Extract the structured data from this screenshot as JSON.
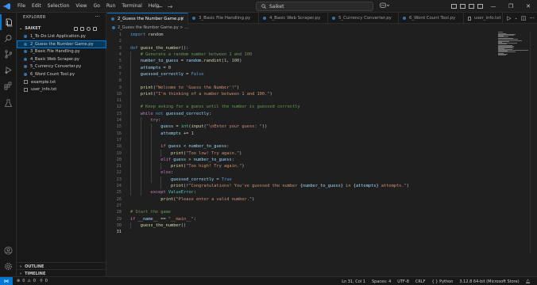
{
  "menu": [
    "File",
    "Edit",
    "Selection",
    "View",
    "Go",
    "Run",
    "Terminal",
    "Help"
  ],
  "search": {
    "text": "Saiket"
  },
  "explorer": {
    "title": "EXPLORER",
    "folder": "SAIKET",
    "files": [
      {
        "name": "1_To-Do List Application.py",
        "type": "python"
      },
      {
        "name": "2_Guess the Number Game.py",
        "type": "python",
        "selected": true
      },
      {
        "name": "3_Basic File Handling.py",
        "type": "python"
      },
      {
        "name": "4_Basic Web Scraper.py",
        "type": "python"
      },
      {
        "name": "5_Currency Converter.py",
        "type": "python"
      },
      {
        "name": "6_Word Count Tool.py",
        "type": "python"
      },
      {
        "name": "example.txt",
        "type": "text"
      },
      {
        "name": "user_info.txt",
        "type": "text"
      }
    ],
    "outline": "OUTLINE",
    "timeline": "TIMELINE"
  },
  "tabs": [
    {
      "label": "2_Guess the Number Game.py",
      "active": true
    },
    {
      "label": "3_Basic File Handling.py"
    },
    {
      "label": "4_Basic Web Scraper.py"
    },
    {
      "label": "5_Currency Converter.py"
    },
    {
      "label": "6_Word Count Tool.py"
    },
    {
      "label": "user_info.txt"
    }
  ],
  "breadcrumb": "2_Guess the Number Game.py > ...",
  "code_lines": [
    [
      [
        "kw",
        "import"
      ],
      [
        "p",
        " random"
      ]
    ],
    [],
    [
      [
        "kw",
        "def"
      ],
      [
        "p",
        " "
      ],
      [
        "fn",
        "guess_the_number"
      ],
      [
        "p",
        "():"
      ]
    ],
    [
      [
        "p",
        "    "
      ],
      [
        "cm",
        "# Generate a random number between 1 and 100"
      ]
    ],
    [
      [
        "p",
        "    "
      ],
      [
        "var",
        "number_to_guess"
      ],
      [
        "p",
        " = "
      ],
      [
        "var",
        "random"
      ],
      [
        "p",
        "."
      ],
      [
        "fn",
        "randint"
      ],
      [
        "p",
        "("
      ],
      [
        "num",
        "1"
      ],
      [
        "p",
        ", "
      ],
      [
        "num",
        "100"
      ],
      [
        "p",
        ")"
      ]
    ],
    [
      [
        "p",
        "    "
      ],
      [
        "var",
        "attempts"
      ],
      [
        "p",
        " = "
      ],
      [
        "num",
        "0"
      ]
    ],
    [
      [
        "p",
        "    "
      ],
      [
        "var",
        "guessed_correctly"
      ],
      [
        "p",
        " = "
      ],
      [
        "kw",
        "False"
      ]
    ],
    [],
    [
      [
        "p",
        "    "
      ],
      [
        "fn",
        "print"
      ],
      [
        "p",
        "("
      ],
      [
        "str",
        "\"Welcome to 'Guess the Number'!\""
      ],
      [
        "p",
        ")"
      ]
    ],
    [
      [
        "p",
        "    "
      ],
      [
        "fn",
        "print"
      ],
      [
        "p",
        "("
      ],
      [
        "str",
        "\"I'm thinking of a number between 1 and 100.\""
      ],
      [
        "p",
        ")"
      ]
    ],
    [],
    [
      [
        "p",
        "    "
      ],
      [
        "cm",
        "# Keep asking for a guess until the number is guessed correctly"
      ]
    ],
    [
      [
        "p",
        "    "
      ],
      [
        "ctl",
        "while"
      ],
      [
        "p",
        " "
      ],
      [
        "kw",
        "not"
      ],
      [
        "p",
        " "
      ],
      [
        "var",
        "guessed_correctly"
      ],
      [
        "p",
        ":"
      ]
    ],
    [
      [
        "p",
        "        "
      ],
      [
        "ctl",
        "try"
      ],
      [
        "p",
        ":"
      ]
    ],
    [
      [
        "p",
        "            "
      ],
      [
        "var",
        "guess"
      ],
      [
        "p",
        " = "
      ],
      [
        "cls",
        "int"
      ],
      [
        "p",
        "("
      ],
      [
        "fn",
        "input"
      ],
      [
        "p",
        "("
      ],
      [
        "str",
        "\"\\nEnter your guess: \""
      ],
      [
        "p",
        "))"
      ]
    ],
    [
      [
        "p",
        "            "
      ],
      [
        "var",
        "attempts"
      ],
      [
        "p",
        " += "
      ],
      [
        "num",
        "1"
      ]
    ],
    [],
    [
      [
        "p",
        "            "
      ],
      [
        "ctl",
        "if"
      ],
      [
        "p",
        " "
      ],
      [
        "var",
        "guess"
      ],
      [
        "p",
        " < "
      ],
      [
        "var",
        "number_to_guess"
      ],
      [
        "p",
        ":"
      ]
    ],
    [
      [
        "p",
        "                "
      ],
      [
        "fn",
        "print"
      ],
      [
        "p",
        "("
      ],
      [
        "str",
        "\"Too low! Try again.\""
      ],
      [
        "p",
        ")"
      ]
    ],
    [
      [
        "p",
        "            "
      ],
      [
        "ctl",
        "elif"
      ],
      [
        "p",
        " "
      ],
      [
        "var",
        "guess"
      ],
      [
        "p",
        " > "
      ],
      [
        "var",
        "number_to_guess"
      ],
      [
        "p",
        ":"
      ]
    ],
    [
      [
        "p",
        "                "
      ],
      [
        "fn",
        "print"
      ],
      [
        "p",
        "("
      ],
      [
        "str",
        "\"Too high! Try again.\""
      ],
      [
        "p",
        ")"
      ]
    ],
    [
      [
        "p",
        "            "
      ],
      [
        "ctl",
        "else"
      ],
      [
        "p",
        ":"
      ]
    ],
    [
      [
        "p",
        "                "
      ],
      [
        "var",
        "guessed_correctly"
      ],
      [
        "p",
        " = "
      ],
      [
        "kw",
        "True"
      ]
    ],
    [
      [
        "p",
        "                "
      ],
      [
        "fn",
        "print"
      ],
      [
        "p",
        "("
      ],
      [
        "kw",
        "f"
      ],
      [
        "str",
        "\"Congratulations! You've guessed the number "
      ],
      [
        "p",
        "{"
      ],
      [
        "var",
        "number_to_guess"
      ],
      [
        "p",
        "}"
      ],
      [
        "str",
        " in "
      ],
      [
        "p",
        "{"
      ],
      [
        "var",
        "attempts"
      ],
      [
        "p",
        "}"
      ],
      [
        "str",
        " attempts.\""
      ],
      [
        "p",
        ")"
      ]
    ],
    [
      [
        "p",
        "        "
      ],
      [
        "ctl",
        "except"
      ],
      [
        "p",
        " "
      ],
      [
        "cls",
        "ValueError"
      ],
      [
        "p",
        ":"
      ]
    ],
    [
      [
        "p",
        "            "
      ],
      [
        "fn",
        "print"
      ],
      [
        "p",
        "("
      ],
      [
        "str",
        "\"Please enter a valid number.\""
      ],
      [
        "p",
        ")"
      ]
    ],
    [],
    [
      [
        "cm",
        "# Start the game"
      ]
    ],
    [
      [
        "ctl",
        "if"
      ],
      [
        "p",
        " "
      ],
      [
        "var",
        "__name__"
      ],
      [
        "p",
        " == "
      ],
      [
        "str",
        "\"__main__\""
      ],
      [
        "p",
        ":"
      ]
    ],
    [
      [
        "p",
        "    "
      ],
      [
        "fn",
        "guess_the_number"
      ],
      [
        "p",
        "()"
      ]
    ],
    []
  ],
  "status": {
    "errors": "0",
    "warnings": "0",
    "ports": "0",
    "position": "Ln 31, Col 1",
    "spaces": "Spaces: 4",
    "encoding": "UTF-8",
    "eol": "CRLF",
    "language": "Python",
    "interpreter": "3.12.8 64-bit (Microsoft Store)"
  },
  "colors": {
    "kw": "#569cd6",
    "ctl": "#c586c0",
    "fn": "#dcdcaa",
    "var": "#9cdcfe",
    "str": "#ce9178",
    "num": "#b5cea8",
    "cm": "#6a9955",
    "cls": "#4ec9b0",
    "p": "#cccccc",
    "accent": "#0078d4"
  }
}
